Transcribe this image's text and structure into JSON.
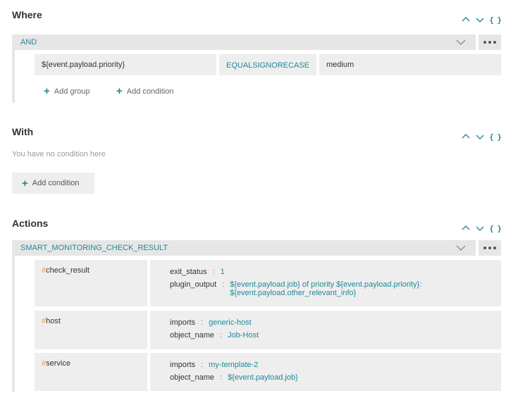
{
  "where": {
    "title": "Where",
    "operator_bar": "AND",
    "condition": {
      "field": "${event.payload.priority}",
      "operator": "EQUALSIGNORECASE",
      "value": "medium"
    },
    "add_group": "Add group",
    "add_condition": "Add condition"
  },
  "with": {
    "title": "With",
    "empty_text": "You have no condition here",
    "add_condition": "Add condition"
  },
  "actions": {
    "title": "Actions",
    "action_bar": "SMART_MONITORING_CHECK_RESULT",
    "rows": [
      {
        "name": "check_result",
        "props": [
          {
            "key": "exit_status",
            "value": "1"
          },
          {
            "key": "plugin_output",
            "value": "${event.payload.job} of priority ${event.payload.priority}: ${event.payload.other_relevant_info}"
          }
        ]
      },
      {
        "name": "host",
        "props": [
          {
            "key": "imports",
            "value": "generic-host"
          },
          {
            "key": "object_name",
            "value": "Job-Host"
          }
        ]
      },
      {
        "name": "service",
        "props": [
          {
            "key": "imports",
            "value": "my-template-2"
          },
          {
            "key": "object_name",
            "value": "${event.payload.job}"
          }
        ]
      }
    ]
  },
  "controls": {
    "json_label": "{ }",
    "separator": ":",
    "hash": "#"
  },
  "colors": {
    "accent": "#1e8a98",
    "hash": "#f0a030",
    "panel": "#eeeeee",
    "bar": "#e6e6e6"
  }
}
